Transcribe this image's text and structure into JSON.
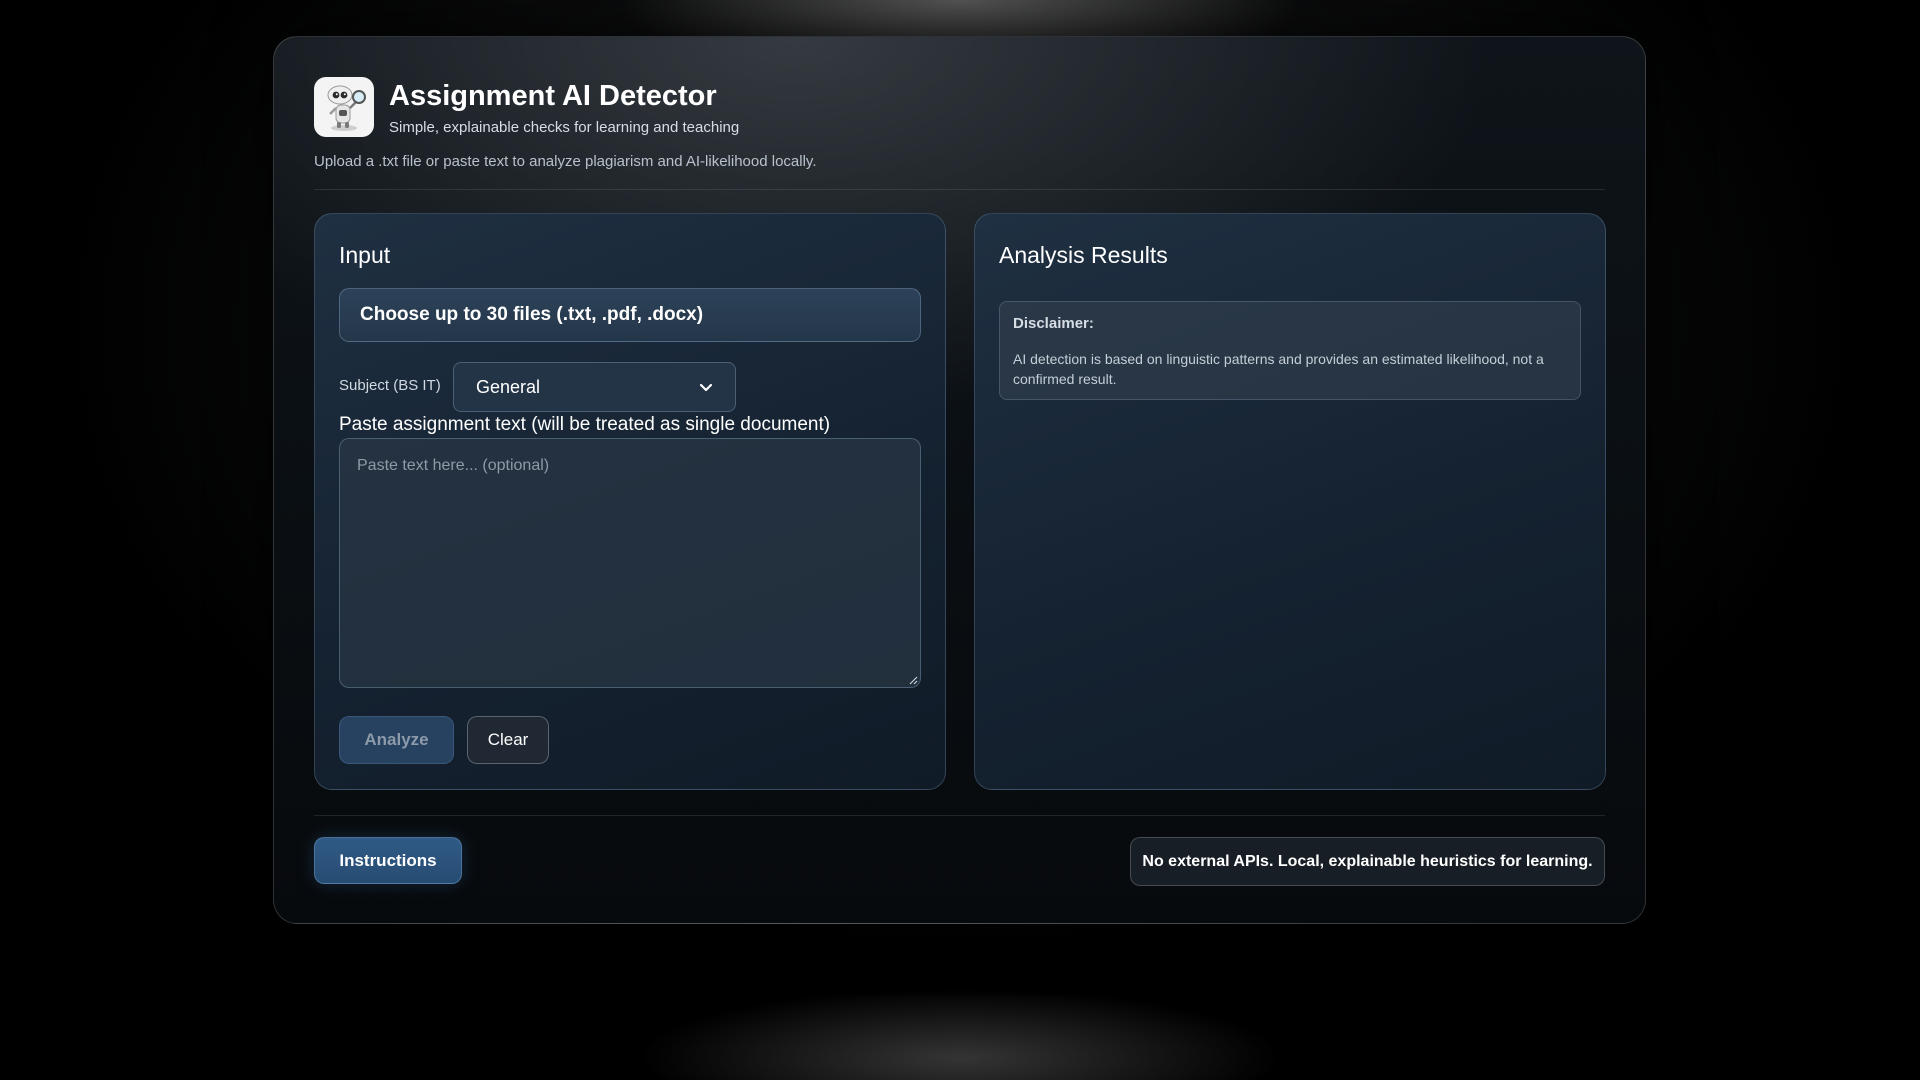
{
  "header": {
    "logo_icon": "robot-magnifier-icon",
    "title": "Assignment AI Detector",
    "subtitle": "Simple, explainable checks for learning and teaching",
    "intro": "Upload a .txt file or paste text to analyze plagiarism and AI-likelihood locally."
  },
  "input_panel": {
    "title": "Input",
    "file_chooser_label": "Choose up to 30 files (.txt, .pdf, .docx)",
    "subject_label": "Subject (BS IT)",
    "subject_value": "General",
    "paste_label": "Paste assignment text (will be treated as single document)",
    "paste_placeholder": "Paste text here... (optional)",
    "analyze_label": "Analyze",
    "clear_label": "Clear"
  },
  "results_panel": {
    "title": "Analysis Results",
    "disclaimer_title": "Disclaimer:",
    "disclaimer_text": "AI detection is based on linguistic patterns and provides an estimated likelihood, not a confirmed result."
  },
  "footer": {
    "instructions_label": "Instructions",
    "note": "No external APIs. Local, explainable heuristics for learning."
  },
  "colors": {
    "background": "#000000",
    "panel": "#1a2939",
    "accent_button": "#2f5a86",
    "text": "#ffffff"
  }
}
